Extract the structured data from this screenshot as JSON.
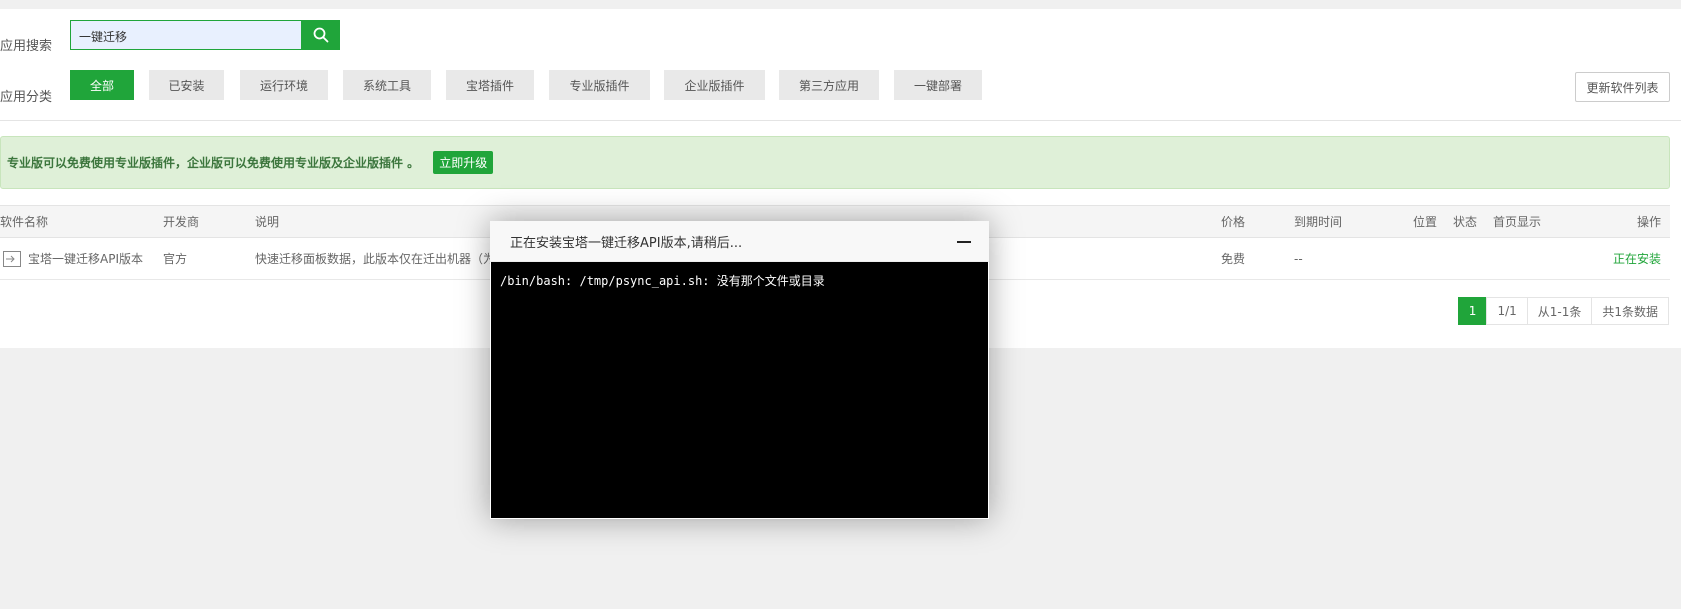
{
  "search": {
    "label": "应用搜索",
    "value": "一键迁移"
  },
  "categories": {
    "label": "应用分类",
    "items": [
      "全部",
      "已安装",
      "运行环境",
      "系统工具",
      "宝塔插件",
      "专业版插件",
      "企业版插件",
      "第三方应用",
      "一键部署"
    ]
  },
  "update_button": "更新软件列表",
  "notice": {
    "text": "专业版可以免费使用专业版插件，企业版可以免费使用专业版及企业版插件 。",
    "button": "立即升级"
  },
  "table": {
    "headers": {
      "name": "软件名称",
      "developer": "开发商",
      "desc": "说明",
      "price": "价格",
      "expire": "到期时间",
      "position": "位置",
      "status": "状态",
      "home": "首页显示",
      "action": "操作"
    },
    "rows": [
      {
        "name": "宝塔一键迁移API版本",
        "developer": "官方",
        "desc": "快速迁移面板数据，此版本仅在迁出机器（为",
        "price": "免费",
        "expire": "--",
        "action": "正在安装"
      }
    ]
  },
  "pager": {
    "current": "1",
    "pages": "1/1",
    "range": "从1-1条",
    "total": "共1条数据"
  },
  "modal": {
    "title": "正在安装宝塔一键迁移API版本,请稍后...",
    "output": "/bin/bash: /tmp/psync_api.sh: 没有那个文件或目录"
  },
  "colors": {
    "accent": "#20a53a",
    "notice_bg": "#dff0d8",
    "terminal_bg": "#000000"
  }
}
